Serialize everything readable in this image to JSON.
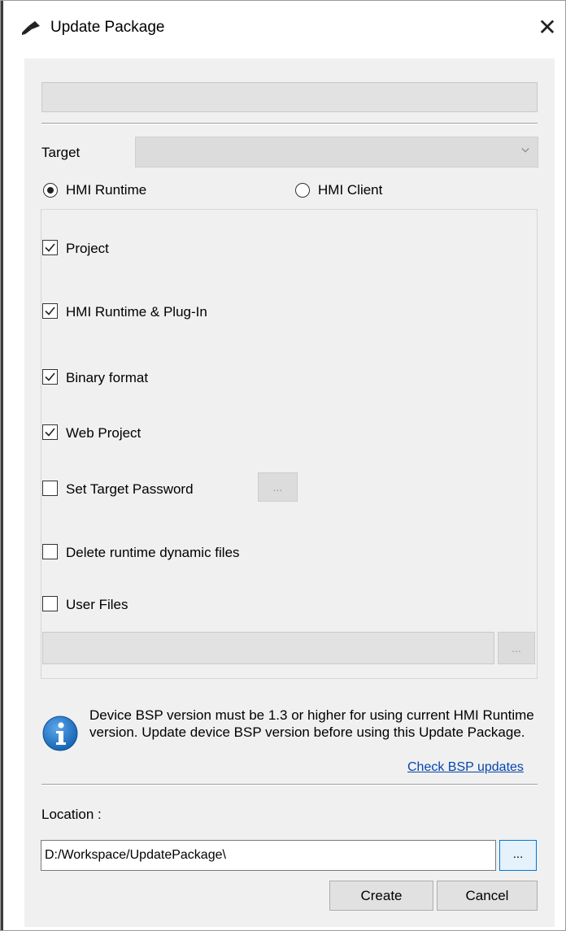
{
  "window": {
    "title": "Update Package",
    "close_symbol": "✕"
  },
  "target": {
    "label": "Target",
    "value": ""
  },
  "mode": {
    "options": [
      {
        "label": "HMI Runtime",
        "selected": true
      },
      {
        "label": "HMI Client",
        "selected": false
      }
    ]
  },
  "options": [
    {
      "label": "Project",
      "checked": true
    },
    {
      "label": "HMI Runtime & Plug-In",
      "checked": true
    },
    {
      "label": "Binary format",
      "checked": true
    },
    {
      "label": "Web Project",
      "checked": true
    },
    {
      "label": "Set Target Password",
      "checked": false
    },
    {
      "label": "Delete runtime dynamic files",
      "checked": false
    },
    {
      "label": "User Files",
      "checked": false
    }
  ],
  "password_browse_label": "...",
  "user_files": {
    "value": "",
    "browse_label": "..."
  },
  "info": {
    "message": "Device BSP version must be 1.3 or higher for using current HMI Runtime version. Update device BSP version before using this Update Package.",
    "link": "Check BSP updates"
  },
  "location": {
    "label": "Location :",
    "value": "D:/Workspace/UpdatePackage\\",
    "browse_label": "..."
  },
  "buttons": {
    "create": "Create",
    "cancel": "Cancel"
  },
  "colors": {
    "link": "#0645ad",
    "focus": "#0078d7",
    "info_icon": "#1a73c9"
  }
}
